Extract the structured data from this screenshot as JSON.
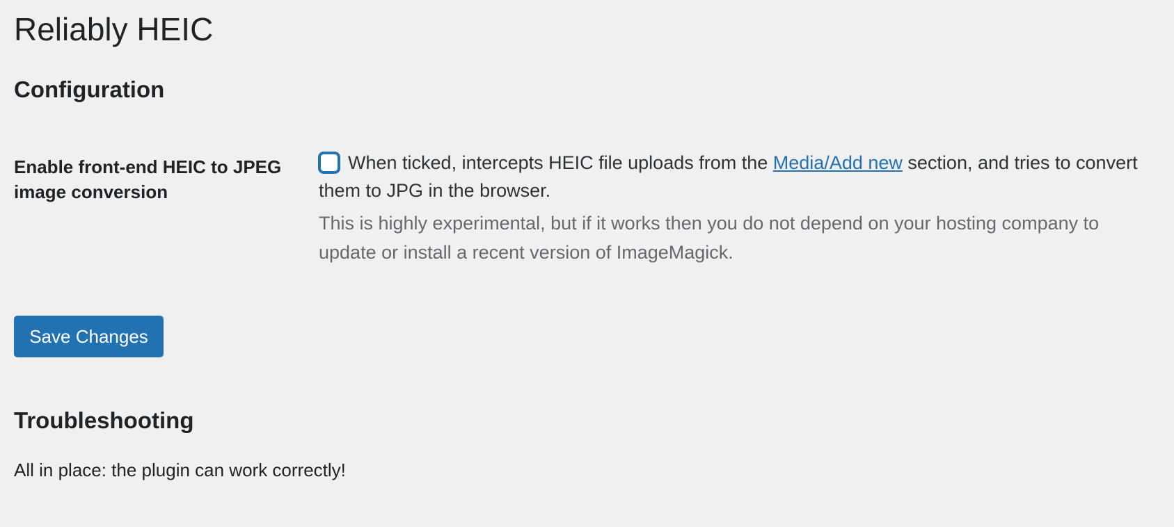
{
  "page": {
    "title": "Reliably HEIC"
  },
  "configuration": {
    "heading": "Configuration",
    "field_label": "Enable front-end HEIC to JPEG image conversion",
    "checkbox_checked": false,
    "text_before_link": "When ticked, intercepts HEIC file uploads from the ",
    "link_text": "Media/Add new",
    "text_after_link": " section, and tries to convert them to JPG in the browser.",
    "description": "This is highly experimental, but if it works then you do not depend on your hosting company to update or install a recent version of ImageMagick."
  },
  "actions": {
    "save_label": "Save Changes"
  },
  "troubleshooting": {
    "heading": "Troubleshooting",
    "status_text": "All in place: the plugin can work correctly!"
  },
  "colors": {
    "background": "#f0f0f1",
    "accent": "#2271b1",
    "text": "#1d2327",
    "muted_text": "#646970"
  }
}
